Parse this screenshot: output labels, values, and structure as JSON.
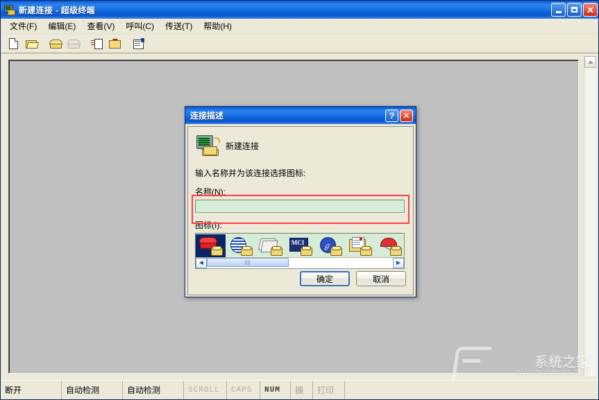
{
  "window": {
    "title": "新建连接 - 超级终端",
    "title_icon": "hyperterminal-icon",
    "minimize_label": "",
    "maximize_label": "",
    "close_label": "✕"
  },
  "menu": {
    "items": [
      {
        "label": "文件(F)",
        "name": "menu-file"
      },
      {
        "label": "编辑(E)",
        "name": "menu-edit"
      },
      {
        "label": "查看(V)",
        "name": "menu-view"
      },
      {
        "label": "呼叫(C)",
        "name": "menu-call"
      },
      {
        "label": "传送(T)",
        "name": "menu-transfer"
      },
      {
        "label": "帮助(H)",
        "name": "menu-help"
      }
    ]
  },
  "toolbar": {
    "buttons": [
      {
        "icon": "new-document-icon",
        "enabled": true
      },
      {
        "icon": "open-folder-icon",
        "enabled": true
      },
      {
        "icon": "call-phone-icon",
        "enabled": true
      },
      {
        "icon": "disconnect-phone-icon",
        "enabled": false
      },
      {
        "icon": "send-file-icon",
        "enabled": true
      },
      {
        "icon": "receive-file-icon",
        "enabled": true
      },
      {
        "icon": "properties-icon",
        "enabled": true
      }
    ]
  },
  "dialog": {
    "title": "连接描述",
    "help_button": "?",
    "close_button": "✕",
    "connection_icon": "computer-modem-icon",
    "connection_name": "新建连接",
    "prompt": "输入名称并为该连接选择图标:",
    "name_label": "名称(N):",
    "name_value": "",
    "name_placeholder": "",
    "icon_label": "图标(I):",
    "icons": [
      {
        "name": "icon-red-phone",
        "selected": true,
        "art": "phone"
      },
      {
        "name": "icon-globe-lines",
        "selected": false,
        "art": "globe"
      },
      {
        "name": "icon-papers",
        "selected": false,
        "art": "papers"
      },
      {
        "name": "icon-mci",
        "selected": false,
        "art": "mci",
        "text": "MCI"
      },
      {
        "name": "icon-blue-globe",
        "selected": false,
        "art": "bglobe",
        "text": "ℊ"
      },
      {
        "name": "icon-documents",
        "selected": false,
        "art": "docs"
      },
      {
        "name": "icon-umbrella",
        "selected": false,
        "art": "umb"
      }
    ],
    "scroll_left": "◄",
    "scroll_right": "►",
    "ok_label": "确定",
    "cancel_label": "取消"
  },
  "statusbar": {
    "connection_state": "断开",
    "cells": [
      {
        "label": "自动检测",
        "state": "normal",
        "name": "status-auto-detect-1"
      },
      {
        "label": "自动检测",
        "state": "normal",
        "name": "status-auto-detect-2"
      },
      {
        "label": "SCROLL",
        "state": "dim",
        "name": "status-scroll"
      },
      {
        "label": "CAPS",
        "state": "dim",
        "name": "status-caps"
      },
      {
        "label": "NUM",
        "state": "on",
        "name": "status-num"
      },
      {
        "label": "捕",
        "state": "dim2",
        "name": "status-capture"
      },
      {
        "label": "打印",
        "state": "dim2",
        "name": "status-print"
      }
    ]
  },
  "watermark": {
    "text": "系统之家",
    "subtext": "XITONGZHIJIA.NET"
  },
  "colors": {
    "title_blue": "#0a5fd4",
    "dialog_face": "#ece9d8",
    "terminal_bg": "#c0c0c0",
    "field_green": "#d6ecd6",
    "highlight_red": "#ff4040",
    "selection_blue": "#0a246a"
  }
}
